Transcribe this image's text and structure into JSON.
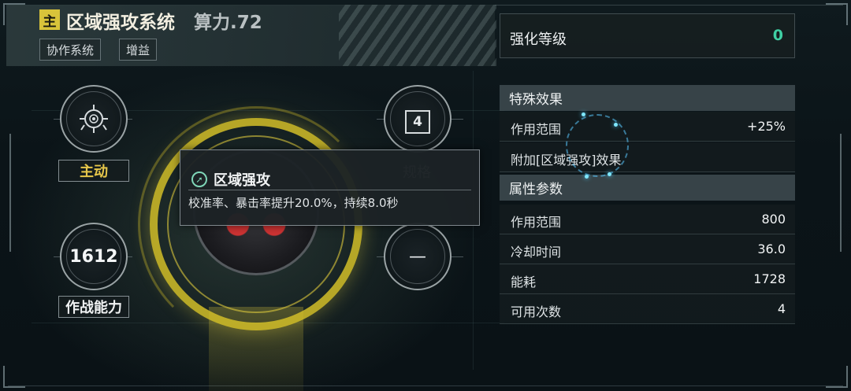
{
  "header": {
    "badge": "主",
    "title": "区域强攻系统",
    "power": "算力.72",
    "tags": [
      "协作系统",
      "增益"
    ]
  },
  "left": {
    "mode_label": "主动",
    "combat_value": "1612",
    "combat_label": "作战能力"
  },
  "right_mid": {
    "spec_value": "4",
    "spec_label": "规格",
    "lower_value": "—"
  },
  "tooltip": {
    "title": "区域强攻",
    "description": "校准率、暴击率提升20.0%，持续8.0秒"
  },
  "upgrade": {
    "label": "强化等级",
    "value": "0"
  },
  "special": {
    "title": "特殊效果",
    "rows": [
      {
        "key": "作用范围",
        "value": "+25%"
      },
      {
        "key": "附加[区域强攻]效果",
        "value": ""
      }
    ]
  },
  "attributes": {
    "title": "属性参数",
    "rows": [
      {
        "key": "作用范围",
        "value": "800"
      },
      {
        "key": "冷却时间",
        "value": "36.0"
      },
      {
        "key": "能耗",
        "value": "1728"
      },
      {
        "key": "可用次数",
        "value": "4"
      }
    ]
  },
  "colors": {
    "accent_gold": "#d8c33a",
    "accent_green": "#3fd0a4",
    "glow_blue": "#4fd0ff",
    "core_red": "#cc3333"
  },
  "icons": {
    "mode": "target-crosshair-icon",
    "tooltip": "arrow-target-icon"
  }
}
